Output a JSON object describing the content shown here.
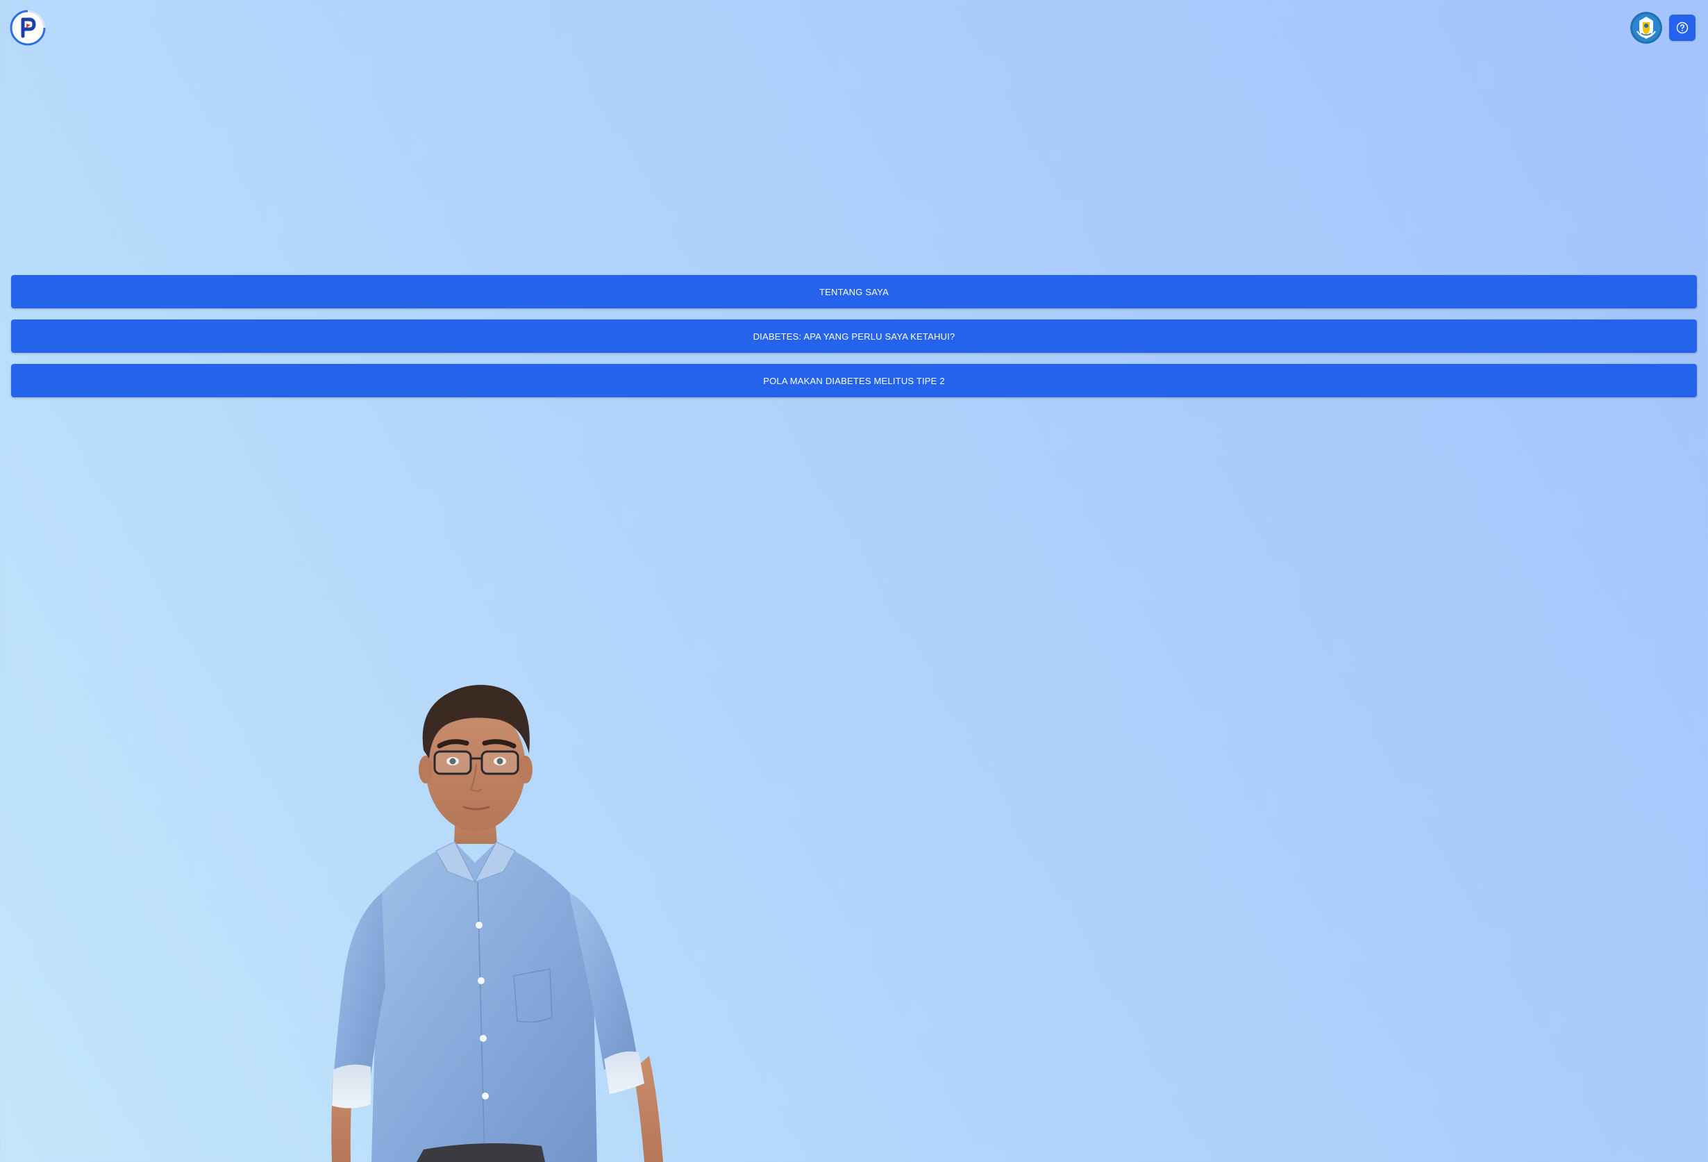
{
  "header": {
    "logo_icon": "p-logo-icon",
    "emblem_icon": "tut-wuri-handayani-emblem-icon",
    "help_icon": "question-circle-icon"
  },
  "menu": {
    "items": [
      {
        "label": "TENTANG SAYA"
      },
      {
        "label": "DIABETES: APA YANG PERLU SAYA KETAHUI?"
      },
      {
        "label": "POLA MAKAN DIABETES MELITUS TIPE 2"
      }
    ]
  },
  "colors": {
    "button": "#2563eb",
    "button_text": "#ffffff",
    "background_start": "#c3e6fb",
    "background_end": "#a3c3fb"
  }
}
